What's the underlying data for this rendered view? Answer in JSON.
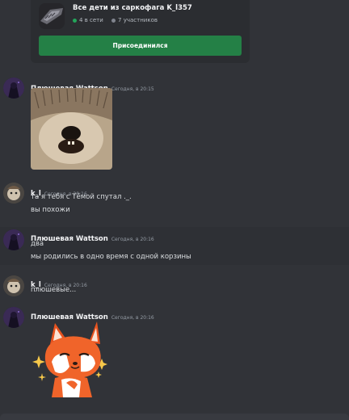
{
  "invite": {
    "server_name": "Все дети из саркофага K_l357",
    "online": "4 в сети",
    "members": "7 участников",
    "join_label": "Присоединился"
  },
  "messages": [
    {
      "author": "Плюшевая Wattson",
      "timestamp": "Сегодня, в 20:15",
      "lines": [],
      "attachment": "image-hedgehog"
    },
    {
      "author": "k_l",
      "timestamp": "Сегодня, в 20:16",
      "lines": [
        "та я тебя с Тёмой спутал ._.",
        "вы похожи"
      ]
    },
    {
      "author": "Плюшевая Wattson",
      "timestamp": "Сегодня, в 20:16",
      "lines": [
        "два",
        "мы родились в одно время с одной корзины"
      ]
    },
    {
      "author": "k_l",
      "timestamp": "Сегодня, в 20:16",
      "lines": [
        "плюшевые..."
      ]
    },
    {
      "author": "Плюшевая Wattson",
      "timestamp": "Сегодня, в 20:16",
      "lines": [],
      "attachment": "sticker-fox"
    }
  ]
}
